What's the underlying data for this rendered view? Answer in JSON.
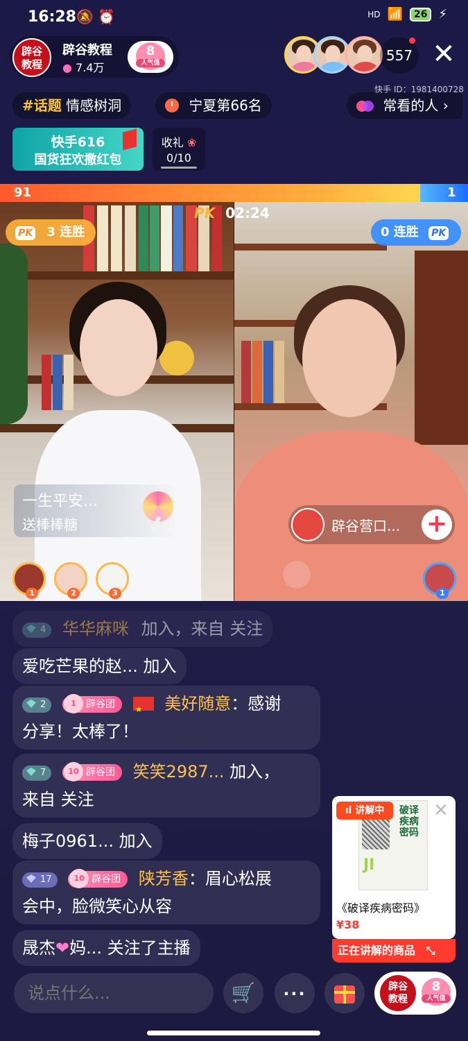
{
  "status_bar": {
    "time": "16:28",
    "battery": "26",
    "network": "HD"
  },
  "host": {
    "name": "辟谷教程",
    "likes": "7.4万",
    "avatar_text": "辟谷\n教程",
    "badge_level": "8",
    "badge_label": "人气值"
  },
  "viewers": {
    "count": "557"
  },
  "kuaishou_id": "快手 ID：1981400728",
  "topic": {
    "hash": "#话题",
    "label": "情感树洞"
  },
  "rank": {
    "label": "宁夏第66名"
  },
  "often_watched": {
    "label": "常看的人"
  },
  "promo": {
    "line1": "快手616",
    "line2": "国货狂欢撒红包"
  },
  "gift_receive": {
    "title": "收礼",
    "count": "0/10"
  },
  "pk": {
    "left_score": "91",
    "right_score": "1",
    "timer": "02:24",
    "logo": "PK",
    "left_streak": "3 连胜",
    "right_streak": "0 连胜"
  },
  "gift_notice": {
    "name": "一生平安...",
    "desc": "送棒棒糖"
  },
  "guest": {
    "name": "辟谷营口..."
  },
  "rank_avatars": {
    "left": [
      "1",
      "2",
      "3"
    ],
    "right": [
      "1"
    ]
  },
  "chat": [
    {
      "level": "4",
      "user": "华华麻咪",
      "text": "加入，来自 关注"
    },
    {
      "text": "爱吃芒果的赵... 加入"
    },
    {
      "level": "2",
      "fan_level": "1",
      "fan_group": "辟谷团",
      "user": "美好随意",
      "text_line1": "：感谢",
      "text_line2": "分享！太棒了！"
    },
    {
      "level": "7",
      "fan_level": "10",
      "fan_group": "辟谷团",
      "user": "笑笑2987...",
      "text_line1": " 加入，",
      "text_line2": "来自 关注"
    },
    {
      "text": "梅子0961... 加入"
    },
    {
      "level": "17",
      "fan_level": "10",
      "fan_group": "辟谷团",
      "user": "陕芳香",
      "text_line1": "：眉心松展",
      "text_line2": "会中，脸微笑心从容"
    },
    {
      "text_a": "晟杰",
      "text_b": "妈... 关注了主播"
    }
  ],
  "product": {
    "tag": "讲解中",
    "book_title": "破译疾病密码",
    "book_spine": "JI",
    "name": "《破译疾病密码》",
    "price": "¥38",
    "footer": "正在讲解的商品"
  },
  "bottom": {
    "comment_placeholder": "说点什么...",
    "more": "···"
  },
  "colors": {
    "accent_orange": "#ff5a2e",
    "accent_blue": "#1e6cff",
    "gold": "#ffc14a"
  }
}
